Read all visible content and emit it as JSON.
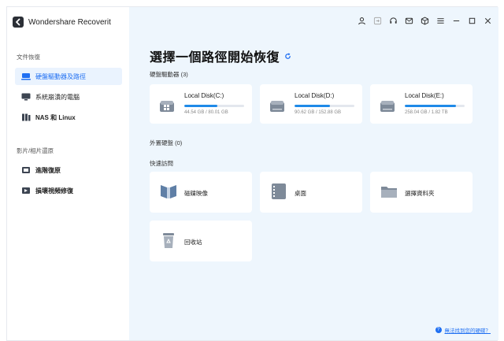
{
  "app": {
    "title": "Wondershare Recoverit"
  },
  "sidebar": {
    "section1_label": "文件恢復",
    "section2_label": "影片/相片還原",
    "items": [
      {
        "label": "硬盤驅動器及路徑",
        "icon": "hard-drive-icon"
      },
      {
        "label": "系統崩潰的電腦",
        "icon": "monitor-icon"
      },
      {
        "label": "NAS 和 Linux",
        "icon": "nas-icon"
      },
      {
        "label": "進階復原",
        "icon": "advanced-recovery-icon"
      },
      {
        "label": "損壞視頻修復",
        "icon": "video-repair-icon"
      }
    ]
  },
  "main": {
    "title": "選擇一個路徑開始恢復",
    "hard_drives": {
      "label": "硬盤驅動器",
      "count": "(3)",
      "disks": [
        {
          "name": "Local Disk(C:)",
          "size": "44.54 GB / 80.01 GB",
          "used_fraction": 0.556
        },
        {
          "name": "Local Disk(D:)",
          "size": "90.62 GB / 152.88 GB",
          "used_fraction": 0.593
        },
        {
          "name": "Local Disk(E:)",
          "size": "258.04 GB / 1.82 TB",
          "used_fraction": 0.86
        }
      ]
    },
    "external_label": "外置硬盤 (0)",
    "quick_access_label": "快速訪問",
    "quick_access": [
      {
        "label": "磁碟映像",
        "icon": "disk-image-icon"
      },
      {
        "label": "桌面",
        "icon": "desktop-icon"
      },
      {
        "label": "選擇資料夾",
        "icon": "folder-icon"
      },
      {
        "label": "回收站",
        "icon": "recycle-bin-icon"
      }
    ]
  },
  "help": {
    "text": "無法找到您的硬碟？"
  },
  "colors": {
    "accent": "#1f6ff2",
    "bar": "#1f8ae8",
    "main_bg": "#eef6fd"
  }
}
